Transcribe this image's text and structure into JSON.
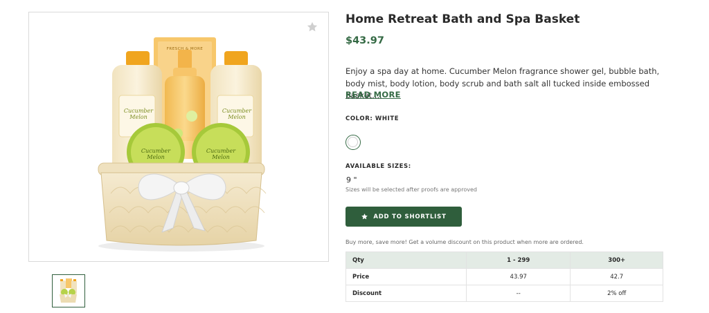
{
  "product": {
    "title": "Home Retreat Bath and Spa Basket",
    "price": "$43.97",
    "description": "Enjoy a spa day at home. Cucumber Melon fragrance shower gel, bubble bath, body mist, body lotion, body scrub and bath salt all tucked inside embossed basket....",
    "read_more": "READ MORE",
    "favorite_icon": "star-icon",
    "image_alt": "Cucumber Melon bath and spa basket",
    "bottle_label": "Cucumber Melon",
    "brand_label": "FRESCH & MORE"
  },
  "color": {
    "label": "COLOR: WHITE",
    "swatch_color": "#ffffff"
  },
  "sizes": {
    "label": "AVAILABLE SIZES:",
    "value": "9 \"",
    "note": "Sizes will be selected after proofs are approved"
  },
  "cta": {
    "label": "ADD TO SHORTLIST",
    "icon": "star-icon",
    "color": "#2f5e3c"
  },
  "volume": {
    "note": "Buy more, save more! Get a volume discount on this product when more are ordered.",
    "headers": [
      "Qty",
      "1 - 299",
      "300+"
    ],
    "rows": [
      [
        "Price",
        "43.97",
        "42.7"
      ],
      [
        "Discount",
        "--",
        "2% off"
      ]
    ]
  }
}
